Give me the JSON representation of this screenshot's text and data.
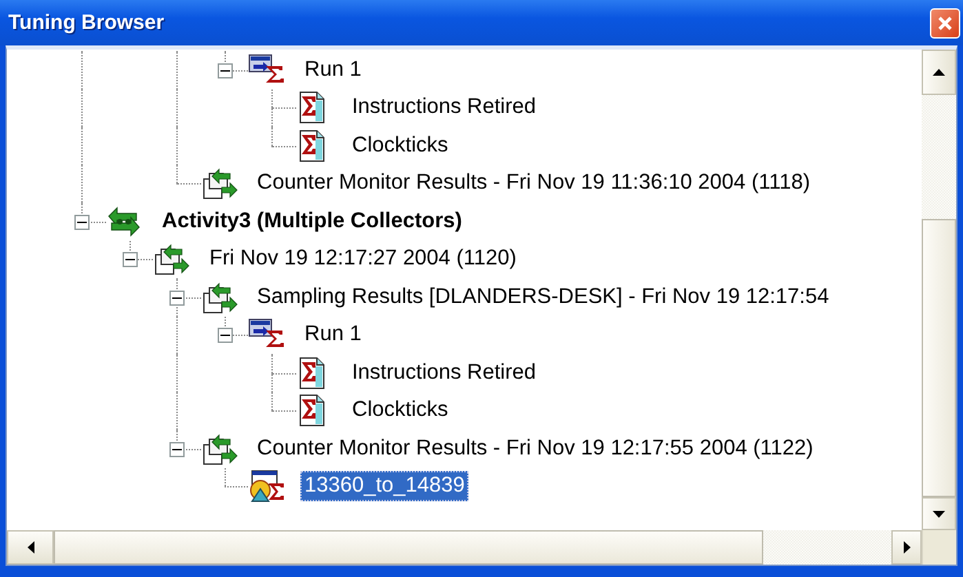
{
  "window": {
    "title": "Tuning Browser"
  },
  "tree": {
    "roots": [
      {
        "children": [
          {
            "children": [
              {
                "children": [
                  {
                    "kind": "run",
                    "label": "Run 1",
                    "expanded": true,
                    "selected": false,
                    "children": [
                      {
                        "kind": "event",
                        "label": "Instructions Retired",
                        "selected": false
                      },
                      {
                        "kind": "event",
                        "label": "Clockticks",
                        "selected": false
                      }
                    ]
                  }
                ]
              },
              {
                "kind": "results",
                "label": "Counter Monitor Results - Fri Nov 19 11:36:10 2004 (1118)",
                "selected": false
              }
            ]
          }
        ]
      },
      {
        "kind": "activity",
        "label": "Activity3 (Multiple Collectors)",
        "expanded": true,
        "selected": false,
        "children": [
          {
            "kind": "results",
            "label": "Fri Nov 19 12:17:27 2004 (1120)",
            "expanded": true,
            "selected": false,
            "children": [
              {
                "kind": "results",
                "label": "Sampling Results [DLANDERS-DESK] - Fri Nov 19 12:17:54",
                "expanded": true,
                "selected": false,
                "children": [
                  {
                    "kind": "run",
                    "label": "Run 1",
                    "expanded": true,
                    "selected": false,
                    "children": [
                      {
                        "kind": "event",
                        "label": "Instructions Retired",
                        "selected": false
                      },
                      {
                        "kind": "event",
                        "label": "Clockticks",
                        "selected": false
                      }
                    ]
                  }
                ]
              },
              {
                "kind": "results",
                "label": "Counter Monitor Results - Fri Nov 19 12:17:55 2004 (1122)",
                "expanded": true,
                "selected": false,
                "children": [
                  {
                    "kind": "graph",
                    "label": "13360_to_14839",
                    "selected": true
                  }
                ]
              }
            ]
          }
        ]
      }
    ]
  }
}
